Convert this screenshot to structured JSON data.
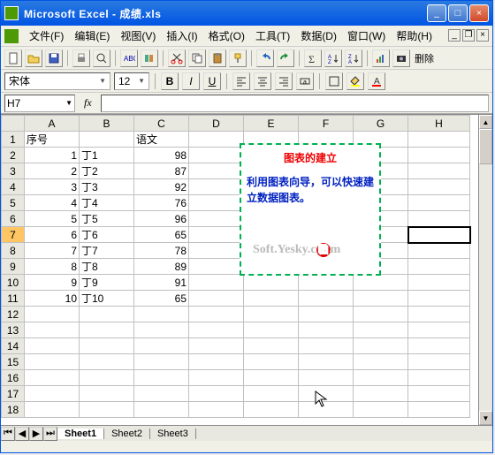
{
  "window": {
    "title": "Microsoft Excel - 成绩.xls"
  },
  "menu": {
    "file": "文件(F)",
    "edit": "编辑(E)",
    "view": "视图(V)",
    "insert": "插入(I)",
    "format": "格式(O)",
    "tools": "工具(T)",
    "data": "数据(D)",
    "window": "窗口(W)",
    "help": "帮助(H)"
  },
  "toolbar": {
    "print_close": "删除"
  },
  "format": {
    "font_name": "宋体",
    "font_size": "12"
  },
  "formula": {
    "namebox": "H7",
    "fx": "fx",
    "value": ""
  },
  "columns": [
    "A",
    "B",
    "C",
    "D",
    "E",
    "F",
    "G",
    "H"
  ],
  "rows": [
    "1",
    "2",
    "3",
    "4",
    "5",
    "6",
    "7",
    "8",
    "9",
    "10",
    "11",
    "12",
    "13",
    "14",
    "15",
    "16",
    "17",
    "18"
  ],
  "header": {
    "A": "序号",
    "C": "语文"
  },
  "data_rows": [
    {
      "a": "1",
      "b": "丁1",
      "c": "98"
    },
    {
      "a": "2",
      "b": "丁2",
      "c": "87"
    },
    {
      "a": "3",
      "b": "丁3",
      "c": "92"
    },
    {
      "a": "4",
      "b": "丁4",
      "c": "76"
    },
    {
      "a": "5",
      "b": "丁5",
      "c": "96"
    },
    {
      "a": "6",
      "b": "丁6",
      "c": "65"
    },
    {
      "a": "7",
      "b": "丁7",
      "c": "78"
    },
    {
      "a": "8",
      "b": "丁8",
      "c": "89"
    },
    {
      "a": "9",
      "b": "丁9",
      "c": "91"
    },
    {
      "a": "10",
      "b": "丁10",
      "c": "65"
    }
  ],
  "textbox": {
    "title": "图表的建立",
    "body": "利用图表向导，可以快速建立数据图表。"
  },
  "watermark": "Soft.Yesky.c  m",
  "tabs": {
    "s1": "Sheet1",
    "s2": "Sheet2",
    "s3": "Sheet3"
  },
  "selected_row": 7
}
